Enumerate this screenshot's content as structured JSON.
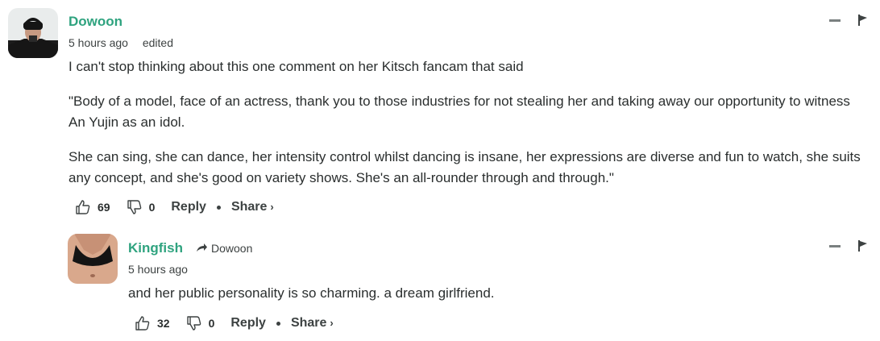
{
  "comments": [
    {
      "username": "Dowoon",
      "time": "5 hours ago",
      "edited": "edited",
      "paragraphs": [
        "I can't stop thinking about this one comment on her Kitsch fancam that said",
        "\"Body of a model, face of an actress, thank you to those industries for not stealing her and taking away our opportunity to witness An Yujin as an idol.",
        "She can sing, she can dance, her intensity control whilst dancing is insane, her expressions are diverse and fun to watch, she suits any concept, and she's good on variety shows. She's an all-rounder through and through.\""
      ],
      "upvotes": "69",
      "downvotes": "0",
      "reply_label": "Reply",
      "share_label": "Share",
      "share_chevron": "›"
    },
    {
      "username": "Kingfish",
      "reply_to": "Dowoon",
      "time": "5 hours ago",
      "paragraphs": [
        "and her public personality is so charming. a dream girlfriend."
      ],
      "upvotes": "32",
      "downvotes": "0",
      "reply_label": "Reply",
      "share_label": "Share",
      "share_chevron": "›"
    }
  ],
  "icons": {
    "upvote": "thumbs-up-icon",
    "downvote": "thumbs-down-icon",
    "collapse": "minus-icon",
    "flag": "flag-icon",
    "reply_arrow": "reply-arrow-icon"
  },
  "colors": {
    "username": "#2fa37f",
    "text": "#2a2e2e",
    "muted": "#3d4242"
  }
}
